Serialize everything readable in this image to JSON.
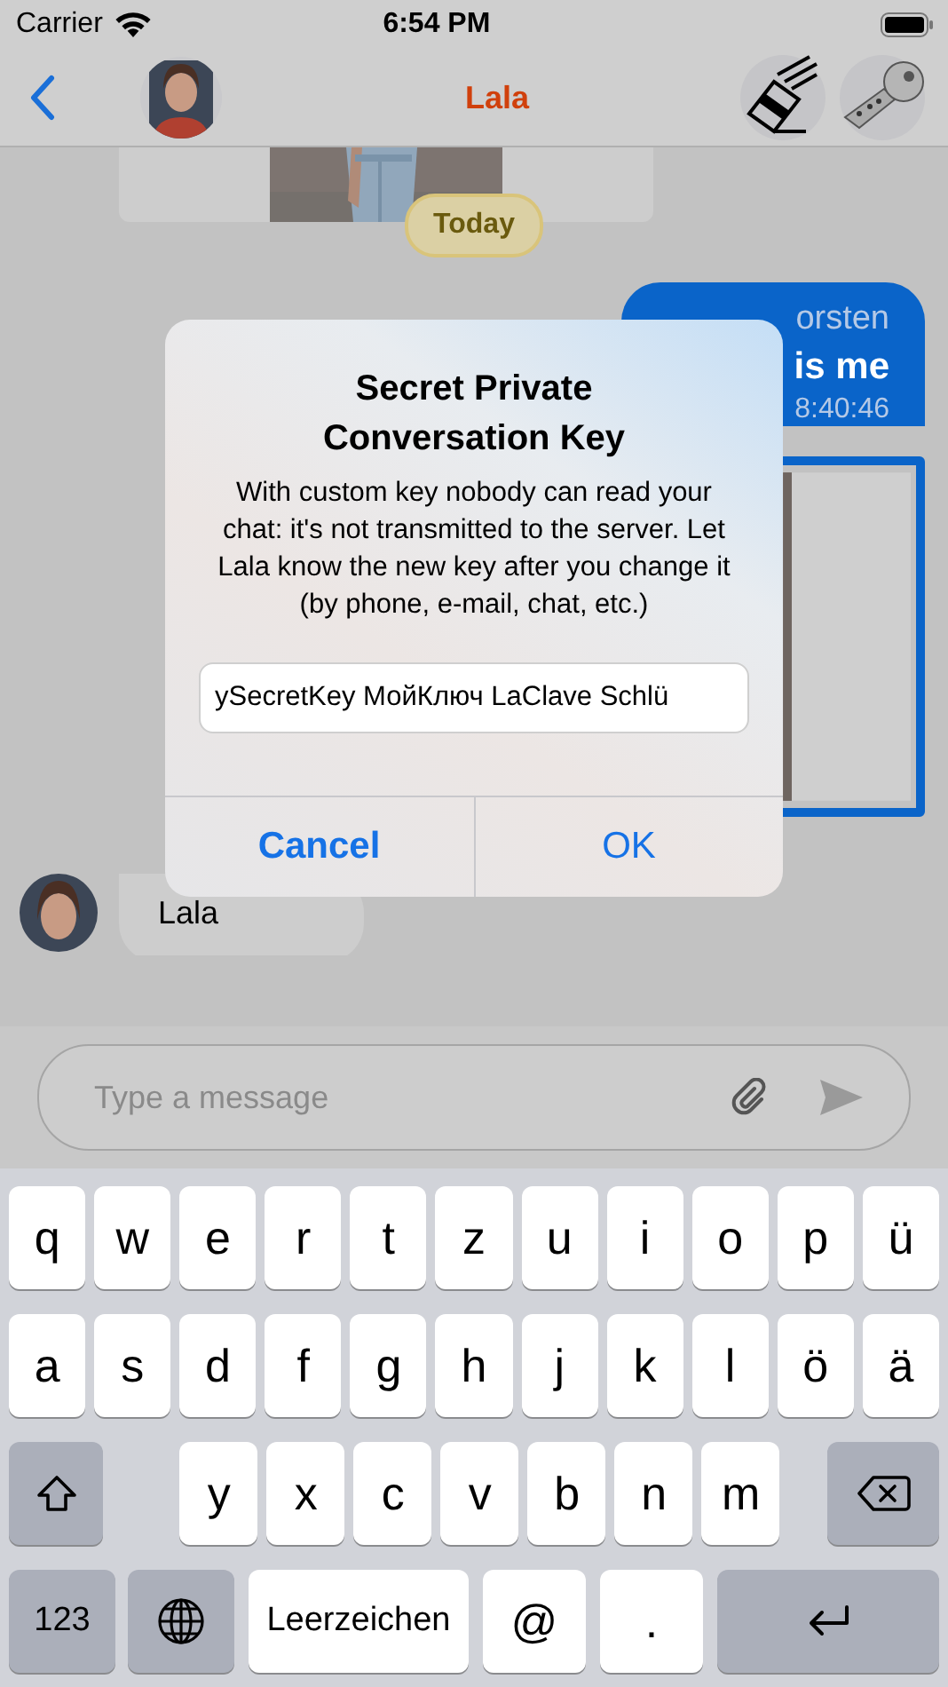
{
  "status_bar": {
    "carrier": "Carrier",
    "time": "6:54 PM"
  },
  "nav_bar": {
    "title": "Lala"
  },
  "chat": {
    "date_badge": "Today",
    "outgoing_message": {
      "sender": "orsten",
      "text": "is me",
      "time": "8:40:46"
    },
    "incoming_message": {
      "sender": "Lala"
    }
  },
  "dialog": {
    "title": "Secret Private Conversation Key",
    "message": "With custom key nobody can read your chat: it's not transmitted to the server. Let Lala know the new key after you change it (by phone, e-mail, chat, etc.)",
    "key_field": {
      "value": "ySecretKey МойКлюч LaClave Schlü"
    },
    "buttons": [
      {
        "label": "Cancel",
        "kind": "cancel"
      },
      {
        "label": "OK",
        "kind": "default"
      }
    ]
  },
  "composer": {
    "placeholder": "Type a message"
  },
  "keyboard": {
    "rows": [
      {
        "keys": [
          {
            "kind": "letter",
            "label": "q"
          },
          {
            "kind": "letter",
            "label": "w"
          },
          {
            "kind": "letter",
            "label": "e"
          },
          {
            "kind": "letter",
            "label": "r"
          },
          {
            "kind": "letter",
            "label": "t"
          },
          {
            "kind": "letter",
            "label": "z"
          },
          {
            "kind": "letter",
            "label": "u"
          },
          {
            "kind": "letter",
            "label": "i"
          },
          {
            "kind": "letter",
            "label": "o"
          },
          {
            "kind": "letter",
            "label": "p"
          },
          {
            "kind": "letter",
            "label": "ü"
          }
        ]
      },
      {
        "keys": [
          {
            "kind": "letter",
            "label": "a"
          },
          {
            "kind": "letter",
            "label": "s"
          },
          {
            "kind": "letter",
            "label": "d"
          },
          {
            "kind": "letter",
            "label": "f"
          },
          {
            "kind": "letter",
            "label": "g"
          },
          {
            "kind": "letter",
            "label": "h"
          },
          {
            "kind": "letter",
            "label": "j"
          },
          {
            "kind": "letter",
            "label": "k"
          },
          {
            "kind": "letter",
            "label": "l"
          },
          {
            "kind": "letter",
            "label": "ö"
          },
          {
            "kind": "letter",
            "label": "ä"
          }
        ]
      },
      {
        "keys": [
          {
            "kind": "shift"
          },
          {
            "kind": "letter",
            "label": "y"
          },
          {
            "kind": "letter",
            "label": "x"
          },
          {
            "kind": "letter",
            "label": "c"
          },
          {
            "kind": "letter",
            "label": "v"
          },
          {
            "kind": "letter",
            "label": "b"
          },
          {
            "kind": "letter",
            "label": "n"
          },
          {
            "kind": "letter",
            "label": "m"
          },
          {
            "kind": "delete"
          }
        ]
      },
      {
        "keys": [
          {
            "kind": "mode",
            "label": "123"
          },
          {
            "kind": "globe"
          },
          {
            "kind": "space",
            "label": "Leerzeichen"
          },
          {
            "kind": "symbol",
            "label": "@"
          },
          {
            "kind": "symbol",
            "label": "."
          },
          {
            "kind": "return"
          }
        ]
      }
    ]
  }
}
